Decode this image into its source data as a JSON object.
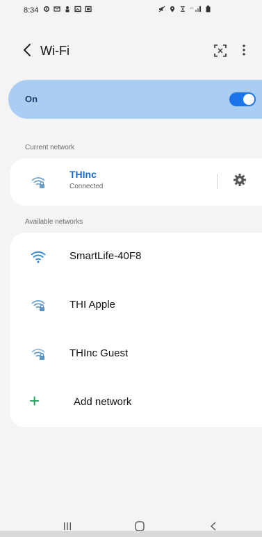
{
  "status_bar": {
    "time": "8:34",
    "icons_left": [
      "gear-icon",
      "message-icon",
      "person-icon",
      "image-icon",
      "photo-icon"
    ],
    "icons_right": [
      "mute-icon",
      "location-icon",
      "alarm-icon",
      "signal-icon",
      "battery-icon"
    ]
  },
  "app_bar": {
    "title": "Wi-Fi",
    "back_icon": "chevron-left-icon",
    "qr_icon": "qr-scan-icon",
    "more_icon": "more-vertical-icon"
  },
  "master_toggle": {
    "label": "On",
    "state": true,
    "accent_color": "#1a73e8",
    "background_color": "#a9cdf3"
  },
  "current_network": {
    "section_label": "Current network",
    "name": "THInc",
    "status": "Connected",
    "secured": true,
    "settings_icon": "gear-icon",
    "name_color": "#1a66c9"
  },
  "available_networks": {
    "section_label": "Available networks",
    "items": [
      {
        "name": "SmartLife-40F8",
        "secured": false
      },
      {
        "name": "THI Apple",
        "secured": true
      },
      {
        "name": "THInc Guest",
        "secured": true
      }
    ],
    "add_network_label": "Add network",
    "add_icon": "plus-icon",
    "add_color": "#22a05a"
  },
  "nav_bar": {
    "recents_icon": "recents-icon",
    "home_icon": "home-icon",
    "back_icon": "back-icon"
  }
}
